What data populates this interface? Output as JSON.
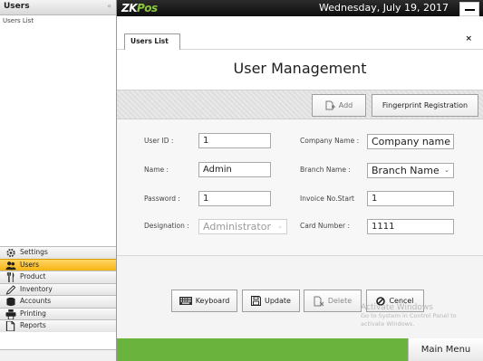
{
  "sidebar": {
    "title": "Users",
    "collapse_glyph": "«",
    "submenu_item": "Users List",
    "items": [
      {
        "label": "Settings",
        "icon": "gear-icon"
      },
      {
        "label": "Users",
        "icon": "users-icon",
        "active": true
      },
      {
        "label": "Product",
        "icon": "cutlery-icon"
      },
      {
        "label": "Inventory",
        "icon": "pencil-icon"
      },
      {
        "label": "Accounts",
        "icon": "coins-icon"
      },
      {
        "label": "Printing",
        "icon": "printer-icon"
      },
      {
        "label": "Reports",
        "icon": "report-icon"
      }
    ]
  },
  "topbar": {
    "logo_main": "ZK",
    "logo_accent": "Pos",
    "datetime": "Wednesday, July 19, 2017"
  },
  "tabs": {
    "active": "Users List",
    "close_glyph": "×"
  },
  "page": {
    "title": "User Management"
  },
  "actions": {
    "add_label": "Add",
    "fingerprint_label": "Fingerprint Registration"
  },
  "form": {
    "user_id_label": "User ID :",
    "user_id_value": "1",
    "name_label": "Name :",
    "name_value": "Admin",
    "password_label": "Password :",
    "password_value": "1",
    "designation_label": "Designation :",
    "designation_value": "Administrator",
    "company_label": "Company Name :",
    "company_value": "Company name",
    "branch_label": "Branch Name :",
    "branch_value": "Branch Name",
    "invoice_label": "Invoice No.Start",
    "invoice_value": "1",
    "card_label": "Card Number :",
    "card_value": "1111"
  },
  "buttons": {
    "keyboard": "Keyboard",
    "update": "Update",
    "delete": "Delete",
    "cancel": "Cencel"
  },
  "watermark": {
    "line1": "Activate Windows",
    "line2": "Go to System in Control Panel to activate Windows."
  },
  "footer": {
    "main_menu": "Main Menu"
  },
  "colors": {
    "accent_green": "#6ab43d",
    "active_orange": "#f6b512",
    "topbar_dark": "#1a1a1a"
  }
}
